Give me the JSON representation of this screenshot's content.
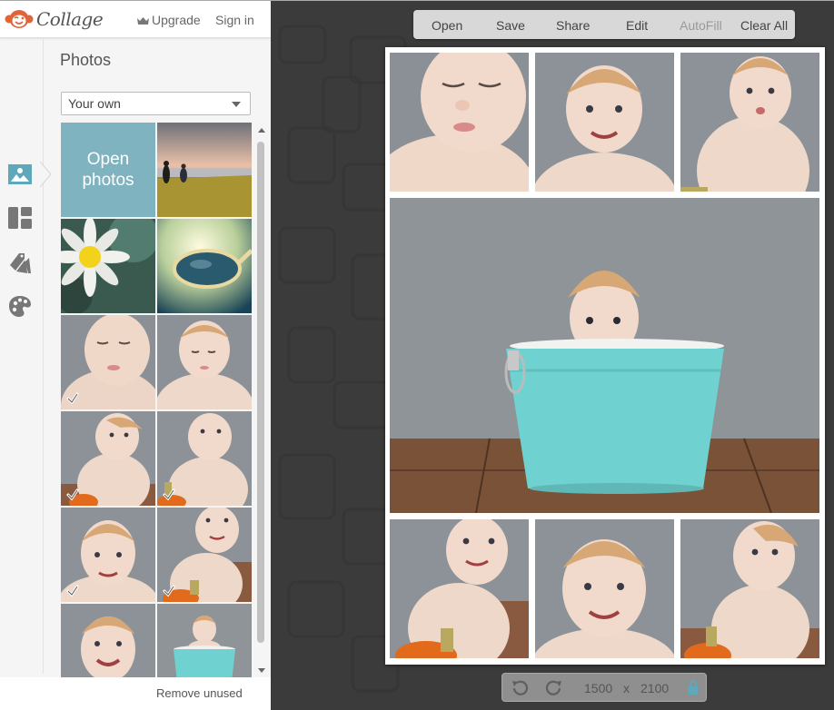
{
  "app": {
    "name": "Collage",
    "upgrade_label": "Upgrade",
    "signin_label": "Sign in"
  },
  "sidebar": {
    "rail": [
      {
        "name": "photos",
        "icon": "image-icon",
        "active": true
      },
      {
        "name": "layouts",
        "icon": "layout-icon",
        "active": false
      },
      {
        "name": "stickers",
        "icon": "tags-icon",
        "active": false
      },
      {
        "name": "backgrounds",
        "icon": "palette-icon",
        "active": false
      }
    ],
    "title": "Photos",
    "source_select": {
      "value": "Your own"
    },
    "open_photos_label": "Open photos",
    "open_photos_line1": "Open",
    "open_photos_line2": "photos",
    "thumbnails": [
      {
        "subject": "beach-sunset",
        "used": false
      },
      {
        "subject": "daisy",
        "used": false
      },
      {
        "subject": "sunglasses",
        "used": false
      },
      {
        "subject": "baby-looking-down",
        "used": true
      },
      {
        "subject": "baby-looking-down-2",
        "used": false
      },
      {
        "subject": "baby-looking-up-pumpkin",
        "used": true
      },
      {
        "subject": "baby-pumpkin-front",
        "used": true
      },
      {
        "subject": "baby-smiling",
        "used": true
      },
      {
        "subject": "baby-smiling-pumpkin",
        "used": true
      },
      {
        "subject": "baby-laughing",
        "used": false
      },
      {
        "subject": "baby-in-bucket",
        "used": false
      }
    ],
    "remove_unused_label": "Remove unused"
  },
  "toolbar": {
    "open": "Open",
    "save": "Save",
    "share": "Share",
    "edit": "Edit",
    "autofill": "AutoFill",
    "clear_all": "Clear All"
  },
  "canvas": {
    "cells": [
      {
        "subject": "baby-looking-down"
      },
      {
        "subject": "baby-smiling"
      },
      {
        "subject": "baby-pumpkin-front"
      },
      {
        "subject": "baby-in-bucket"
      },
      {
        "subject": "baby-smiling-pumpkin"
      },
      {
        "subject": "baby-smiling-closeup"
      },
      {
        "subject": "baby-looking-up-pumpkin"
      }
    ]
  },
  "dimensions": {
    "width": "1500",
    "separator": "x",
    "height": "2100",
    "locked": true
  },
  "colors": {
    "accent": "#5ea8bc",
    "open_tile": "#7fb3c0",
    "logo": "#e0643a",
    "bucket": "#6fd2d0"
  }
}
